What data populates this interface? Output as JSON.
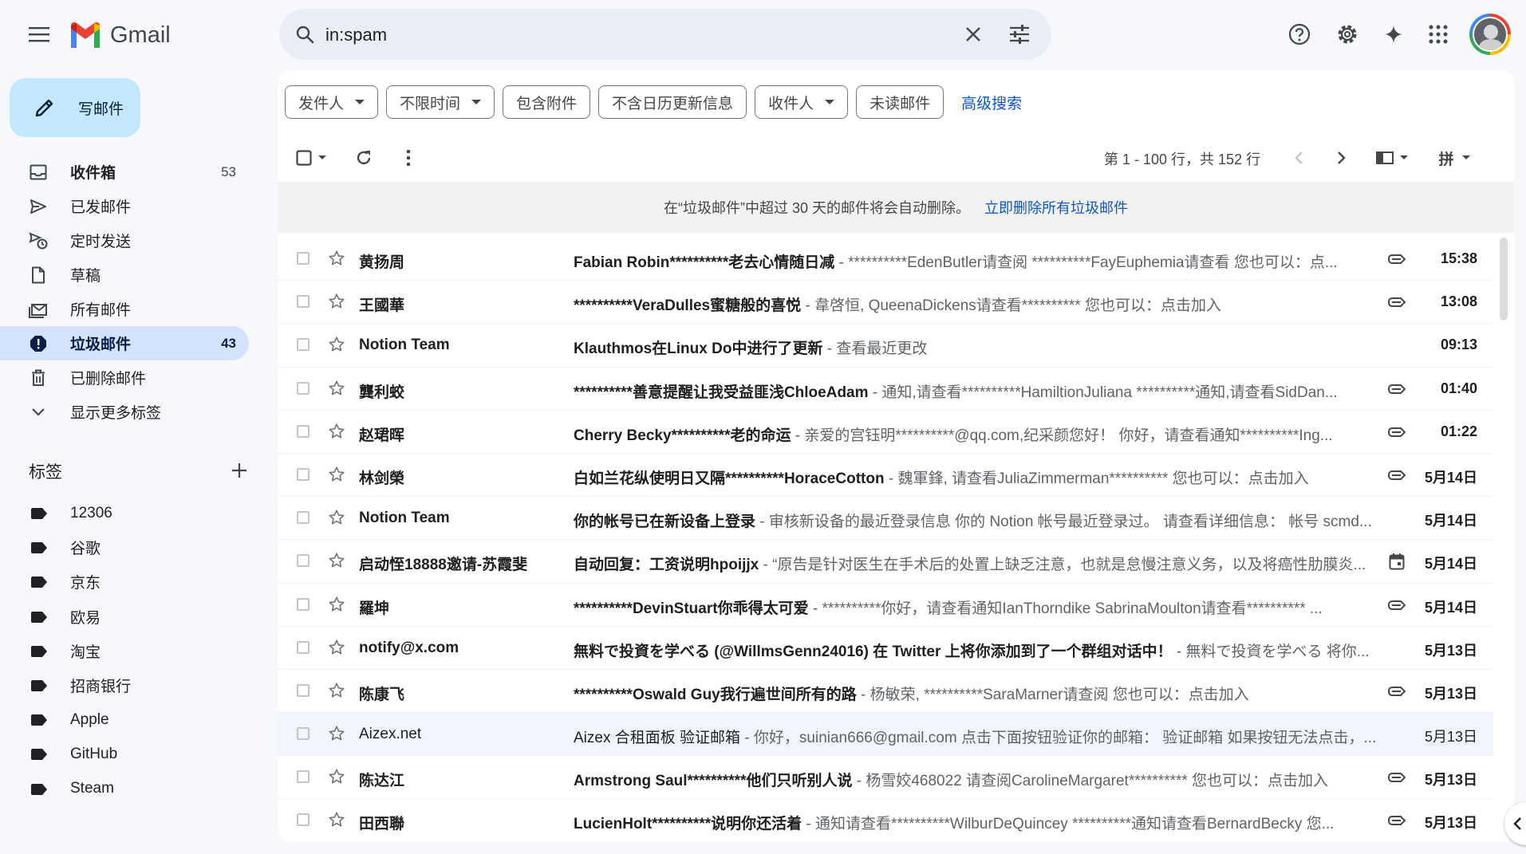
{
  "app": {
    "name": "Gmail"
  },
  "search": {
    "value": "in:spam",
    "placeholder": ""
  },
  "compose": {
    "label": "写邮件"
  },
  "nav": [
    {
      "label": "收件箱",
      "count": "53",
      "icon": "inbox-icon",
      "bold": true
    },
    {
      "label": "已发邮件",
      "count": "",
      "icon": "send-icon"
    },
    {
      "label": "定时发送",
      "count": "",
      "icon": "scheduled-send-icon"
    },
    {
      "label": "草稿",
      "count": "",
      "icon": "draft-icon"
    },
    {
      "label": "所有邮件",
      "count": "",
      "icon": "all-mail-icon"
    },
    {
      "label": "垃圾邮件",
      "count": "43",
      "icon": "spam-icon",
      "active": true
    },
    {
      "label": "已删除邮件",
      "count": "",
      "icon": "trash-icon"
    },
    {
      "label": "显示更多标签",
      "count": "",
      "icon": "chevron-down-icon"
    }
  ],
  "labels": {
    "heading": "标签",
    "items": [
      "12306",
      "谷歌",
      "京东",
      "欧易",
      "淘宝",
      "招商银行",
      "Apple",
      "GitHub",
      "Steam"
    ]
  },
  "filters": {
    "chips": [
      {
        "label": "发件人",
        "dropdown": true
      },
      {
        "label": "不限时间",
        "dropdown": true
      },
      {
        "label": "包含附件",
        "dropdown": false
      },
      {
        "label": "不含日历更新信息",
        "dropdown": false
      },
      {
        "label": "收件人",
        "dropdown": true
      },
      {
        "label": "未读邮件",
        "dropdown": false
      }
    ],
    "advanced": "高级搜索"
  },
  "toolbar": {
    "pagination": "第 1 - 100 行，共 152 行",
    "input_tool": "拼"
  },
  "notice": {
    "text": "在“垃圾邮件”中超过 30 天的邮件将会自动删除。",
    "action": "立即删除所有垃圾邮件"
  },
  "emails": [
    {
      "sender": "黄扬周",
      "subject": "Fabian Robin**********老去心情随日减",
      "snippet": " - **********EdenButler请查阅 **********FayEuphemia请查看 您也可以：点...",
      "date": "15:38",
      "icon": "label-icon",
      "read": false
    },
    {
      "sender": "王國華",
      "subject": "**********VeraDulles蜜糖般的喜悦",
      "snippet": " - 韋啓恒, QueenaDickens请查看********** 您也可以：点击加入",
      "date": "13:08",
      "icon": "label-icon",
      "read": false
    },
    {
      "sender": "Notion Team",
      "subject": "Klauthmos在Linux Do中进行了更新",
      "snippet": " - 查看最近更改",
      "date": "09:13",
      "icon": "",
      "read": false
    },
    {
      "sender": "龔利蛟",
      "subject": "**********善意提醒让我受益匪浅ChloeAdam",
      "snippet": " - 通知,请查看**********HamiltionJuliana **********通知,请查看SidDan...",
      "date": "01:40",
      "icon": "label-icon",
      "read": false
    },
    {
      "sender": "赵珺晖",
      "subject": "Cherry Becky**********老的命运",
      "snippet": " - 亲爱的宫钰明**********@qq.com,纪采颜您好！ 你好，请查看通知**********Ing...",
      "date": "01:22",
      "icon": "label-icon",
      "read": false
    },
    {
      "sender": "林剑榮",
      "subject": "白如兰花纵使明日又隔**********HoraceCotton",
      "snippet": " - 魏軍鋒, 请查看JuliaZimmerman********** 您也可以：点击加入",
      "date": "5月14日",
      "icon": "label-icon",
      "read": false
    },
    {
      "sender": "Notion Team",
      "subject": "你的帐号已在新设备上登录",
      "snippet": " - 审核新设备的最近登录信息 你的 Notion 帐号最近登录过。 请查看详细信息： 帐号 scmd...",
      "date": "5月14日",
      "icon": "",
      "read": false
    },
    {
      "sender": "启动恎18888邀请-苏霞斐",
      "subject": "自动回复：工资说明hpoijjx",
      "snippet": " - “原告是针对医生在手术后的处置上缺乏注意，也就是怠慢注意义务，以及将癌性肋膜炎...",
      "date": "5月14日",
      "icon": "calendar-icon",
      "read": false
    },
    {
      "sender": "羅坤",
      "subject": "**********DevinStuart你乖得太可爱",
      "snippet": " - **********你好，请查看通知IanThorndike SabrinaMoulton请查看********** ...",
      "date": "5月14日",
      "icon": "label-icon",
      "read": false
    },
    {
      "sender": "notify@x.com",
      "subject": "無料で投資を学べる (@WillmsGenn24016) 在 Twitter 上将你添加到了一个群组对话中！",
      "snippet": " - 無料で投資を学べる 将你...",
      "date": "5月13日",
      "icon": "",
      "read": false
    },
    {
      "sender": "陈康飞",
      "subject": "**********Oswald Guy我行遍世间所有的路",
      "snippet": " - 杨敏荣, **********SaraMarner请查阅 您也可以：点击加入",
      "date": "5月13日",
      "icon": "label-icon",
      "read": false
    },
    {
      "sender": "Aizex.net",
      "subject": "Aizex 合租面板 验证邮箱",
      "snippet": " - 你好，suinian666@gmail.com 点击下面按钮验证你的邮箱： 验证邮箱 如果按钮无法点击，...",
      "date": "5月13日",
      "icon": "",
      "read": true
    },
    {
      "sender": "陈达江",
      "subject": "Armstrong Saul**********他们只听别人说",
      "snippet": " - 杨雪姣468022 请查阅CarolineMargaret********** 您也可以：点击加入",
      "date": "5月13日",
      "icon": "label-icon",
      "read": false
    },
    {
      "sender": "田西聯",
      "subject": "LucienHolt**********说明你还活着",
      "snippet": " - 通知请查看**********WilburDeQuincey **********通知请查看BernardBecky 您...",
      "date": "5月13日",
      "icon": "label-icon",
      "read": false
    }
  ],
  "colors": {
    "accent": "#0b57d0",
    "compose_bg": "#c2e7ff",
    "active_nav": "#d3e3fd",
    "background": "#f6f8fc"
  }
}
